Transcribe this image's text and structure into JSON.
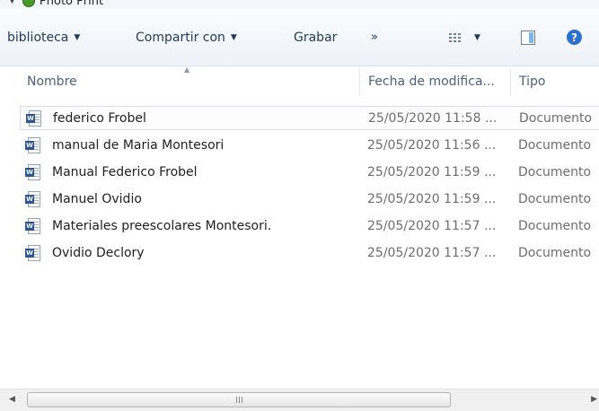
{
  "window": {
    "title": "Photo Print"
  },
  "toolbar": {
    "library_label": "biblioteca",
    "share_label": "Compartir con",
    "burn_label": "Grabar",
    "more_label": "»"
  },
  "columns": {
    "name": "Nombre",
    "date": "Fecha de modifica...",
    "type": "Tipo"
  },
  "files": [
    {
      "name": "federico Frobel",
      "date": "25/05/2020 11:58 ...",
      "type": "Documento",
      "selected": true
    },
    {
      "name": "manual de Maria Montesori",
      "date": "25/05/2020 11:56 ...",
      "type": "Documento"
    },
    {
      "name": "Manual Federico Frobel",
      "date": "25/05/2020 11:59 ...",
      "type": "Documento"
    },
    {
      "name": "Manuel Ovidio",
      "date": "25/05/2020 11:59 ...",
      "type": "Documento"
    },
    {
      "name": "Materiales preescolares Montesori.",
      "date": "25/05/2020 11:57 ...",
      "type": "Documento"
    },
    {
      "name": "Ovidio Declory",
      "date": "25/05/2020 11:57 ...",
      "type": "Documento"
    }
  ],
  "icons": {
    "file": "word-document-icon",
    "views": "change-view-icon",
    "preview": "preview-pane-icon",
    "help": "help-icon"
  },
  "colors": {
    "toolbar_text": "#1e395b",
    "header_text": "#4c607a",
    "meta_text": "#6d6d6d",
    "help_blue": "#2b6fcf"
  }
}
